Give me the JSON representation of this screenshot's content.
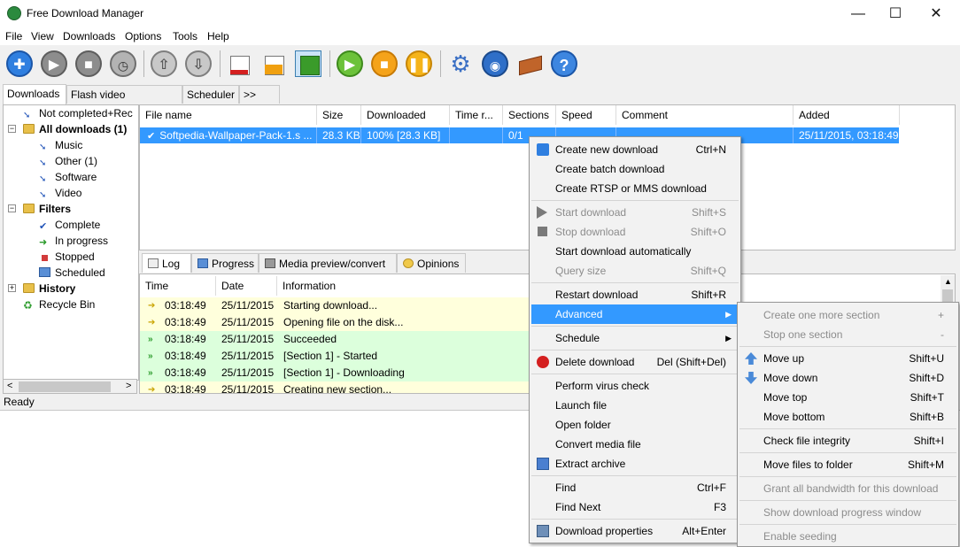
{
  "window": {
    "title": "Free Download Manager",
    "minimize": "—",
    "maximize": "☐",
    "close": "✕"
  },
  "menubar": [
    "File",
    "View",
    "Downloads",
    "Options",
    "Tools",
    "Help"
  ],
  "colors": {
    "selection": "#3399ff",
    "log_yellow": "#ffffdc",
    "log_green": "#dcffdc"
  },
  "top_tabs": [
    "Downloads",
    "Flash video downloads",
    "Scheduler",
    ">>"
  ],
  "tree": {
    "items": [
      {
        "label": "Not completed+Rec",
        "bold": false
      },
      {
        "label": "All downloads (1)",
        "bold": true
      },
      {
        "label": "Music",
        "bold": false
      },
      {
        "label": "Other (1)",
        "bold": false
      },
      {
        "label": "Software",
        "bold": false
      },
      {
        "label": "Video",
        "bold": false
      },
      {
        "label": "Filters",
        "bold": true
      },
      {
        "label": "Complete",
        "bold": false
      },
      {
        "label": "In progress",
        "bold": false
      },
      {
        "label": "Stopped",
        "bold": false
      },
      {
        "label": "Scheduled",
        "bold": false
      },
      {
        "label": "History",
        "bold": true
      },
      {
        "label": "Recycle Bin",
        "bold": false
      }
    ],
    "scroll_left": "<",
    "scroll_right": ">"
  },
  "download_list": {
    "columns": [
      "File name",
      "Size",
      "Downloaded",
      "Time r...",
      "Sections",
      "Speed",
      "Comment",
      "Added"
    ],
    "row": {
      "file_name": "Softpedia-Wallpaper-Pack-1.s ...",
      "size": "28.3 KB",
      "downloaded": "100% [28.3 KB]",
      "time_remaining": "",
      "sections": "0/1",
      "speed": "",
      "comment": "",
      "added": "25/11/2015, 03:18:49"
    }
  },
  "bottom_tabs": [
    "Log",
    "Progress",
    "Media preview/convert",
    "Opinions"
  ],
  "log": {
    "columns": [
      "Time",
      "Date",
      "Information"
    ],
    "rows": [
      {
        "time": "03:18:49",
        "date": "25/11/2015",
        "info": "Starting download...",
        "kind": "yellow"
      },
      {
        "time": "03:18:49",
        "date": "25/11/2015",
        "info": "Opening file on the disk...",
        "kind": "yellow"
      },
      {
        "time": "03:18:49",
        "date": "25/11/2015",
        "info": "Succeeded",
        "kind": "green"
      },
      {
        "time": "03:18:49",
        "date": "25/11/2015",
        "info": "[Section 1] - Started",
        "kind": "green"
      },
      {
        "time": "03:18:49",
        "date": "25/11/2015",
        "info": "[Section 1] - Downloading",
        "kind": "green"
      },
      {
        "time": "03:18:49",
        "date": "25/11/2015",
        "info": "Creating new section...",
        "kind": "yellow"
      }
    ]
  },
  "status": "Ready",
  "context_menu": [
    {
      "label": "Create new download",
      "shortcut": "Ctrl+N",
      "icon": "plus-icon"
    },
    {
      "label": "Create batch download",
      "shortcut": ""
    },
    {
      "label": "Create RTSP or MMS download",
      "shortcut": ""
    },
    {
      "sep": true
    },
    {
      "label": "Start download",
      "shortcut": "Shift+S",
      "disabled": true,
      "icon": "play-icon"
    },
    {
      "label": "Stop download",
      "shortcut": "Shift+O",
      "disabled": true,
      "icon": "stop-icon"
    },
    {
      "label": "Start download automatically",
      "shortcut": ""
    },
    {
      "label": "Query size",
      "shortcut": "Shift+Q",
      "disabled": true
    },
    {
      "sep": true
    },
    {
      "label": "Restart download",
      "shortcut": "Shift+R"
    },
    {
      "label": "Advanced",
      "shortcut": "",
      "submenu": true,
      "highlight": true
    },
    {
      "sep": true
    },
    {
      "label": "Schedule",
      "shortcut": "",
      "submenu": true
    },
    {
      "sep": true
    },
    {
      "label": "Delete download",
      "shortcut": "Del (Shift+Del)",
      "icon": "delete-icon"
    },
    {
      "sep": true
    },
    {
      "label": "Perform virus check",
      "shortcut": ""
    },
    {
      "label": "Launch file",
      "shortcut": ""
    },
    {
      "label": "Open folder",
      "shortcut": ""
    },
    {
      "label": "Convert media file",
      "shortcut": ""
    },
    {
      "label": "Extract archive",
      "shortcut": "",
      "icon": "archive-icon"
    },
    {
      "sep": true
    },
    {
      "label": "Find",
      "shortcut": "Ctrl+F"
    },
    {
      "label": "Find Next",
      "shortcut": "F3"
    },
    {
      "sep": true
    },
    {
      "label": "Download properties",
      "shortcut": "Alt+Enter",
      "icon": "properties-icon"
    }
  ],
  "submenu": [
    {
      "label": "Create one more section",
      "shortcut": "+",
      "disabled": true
    },
    {
      "label": "Stop one section",
      "shortcut": "-",
      "disabled": true
    },
    {
      "sep": true
    },
    {
      "label": "Move up",
      "shortcut": "Shift+U",
      "icon": "up-arrow-icon"
    },
    {
      "label": "Move down",
      "shortcut": "Shift+D",
      "icon": "down-arrow-icon"
    },
    {
      "label": "Move top",
      "shortcut": "Shift+T"
    },
    {
      "label": "Move bottom",
      "shortcut": "Shift+B"
    },
    {
      "sep": true
    },
    {
      "label": "Check file integrity",
      "shortcut": "Shift+I"
    },
    {
      "sep": true
    },
    {
      "label": "Move files to folder",
      "shortcut": "Shift+M"
    },
    {
      "sep": true
    },
    {
      "label": "Grant all bandwidth for this download",
      "shortcut": "",
      "disabled": true
    },
    {
      "sep": true
    },
    {
      "label": "Show download progress window",
      "shortcut": "",
      "disabled": true
    },
    {
      "sep": true
    },
    {
      "label": "Enable seeding",
      "shortcut": "",
      "disabled": true
    }
  ]
}
